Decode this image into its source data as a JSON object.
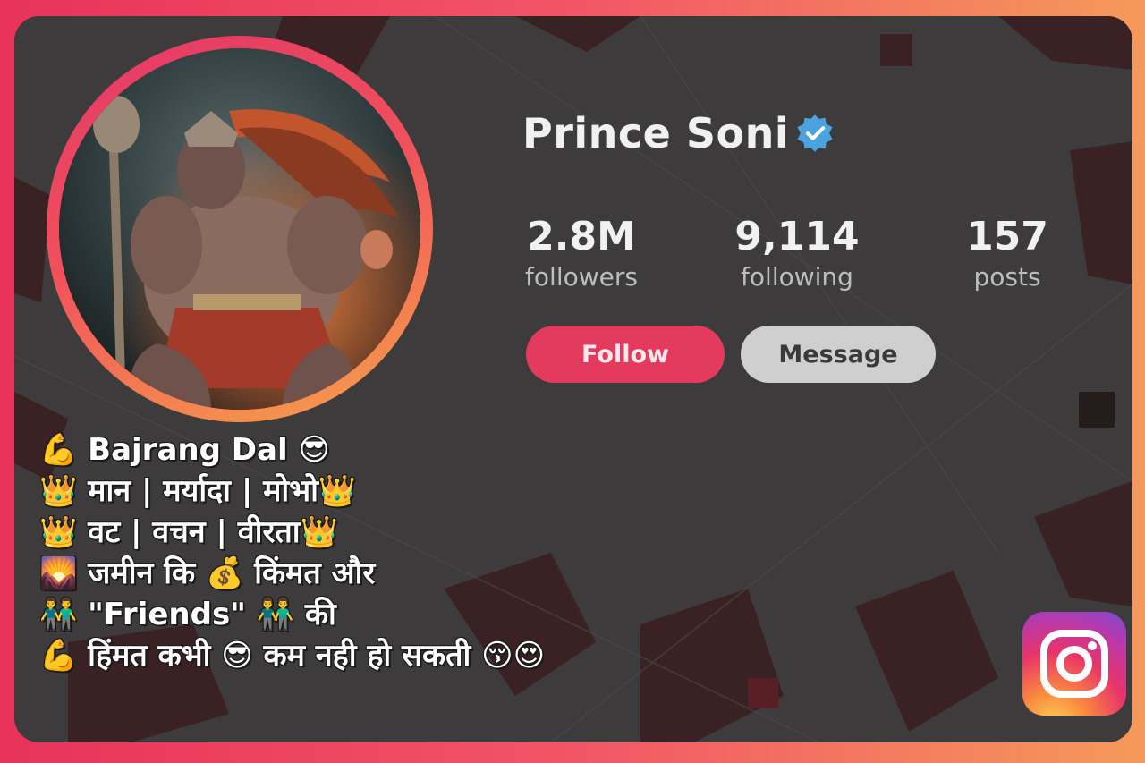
{
  "profile": {
    "name": "Prince Soni",
    "verified_icon": "verified-badge-icon",
    "stats": [
      {
        "value": "2.8M",
        "label": "followers"
      },
      {
        "value": "9,114",
        "label": "following"
      },
      {
        "value": "157",
        "label": "posts"
      }
    ],
    "follow_label": "Follow",
    "message_label": "Message"
  },
  "bio": {
    "lines": [
      "💪 Bajrang Dal 😎",
      "👑 मान | मर्यादा | मोभो👑",
      "👑 वट | वचन | वीरता👑",
      "🌄 जमीन कि 💰 किंमत और",
      "👬 \"Friends\" 👬 की",
      "💪 हिंमत कभी 😎 कम नही हो सकती 😚😍"
    ]
  },
  "icons": {
    "app_logo": "instagram-icon",
    "avatar": "hanuman-avatar-image"
  },
  "colors": {
    "follow": "#e43a5e",
    "message": "#cfcfcf",
    "verified": "#4aa3df",
    "frame_start": "#e8335a",
    "frame_end": "#f59a5a"
  }
}
